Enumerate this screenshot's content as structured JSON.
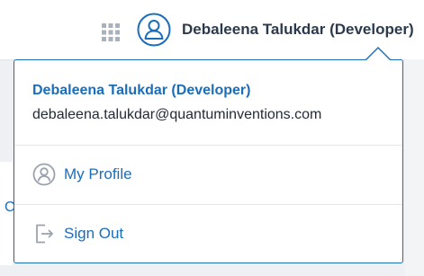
{
  "header": {
    "apps_icon": "grid-apps-icon",
    "avatar_icon": "user-avatar-icon",
    "user_name": "Debaleena Talukdar (Developer)"
  },
  "dropdown": {
    "user_name": "Debaleena Talukdar (Developer)",
    "email": "debaleena.talukdar@quantuminventions.com",
    "items": [
      {
        "label": "My Profile",
        "icon": "user-circle-icon"
      },
      {
        "label": "Sign Out",
        "icon": "sign-out-icon"
      }
    ]
  },
  "background": {
    "partial_letter": "C"
  },
  "colors": {
    "accent": "#1a6dbb",
    "text_dark": "#2b3a4d",
    "icon_gray": "#9aa3ad"
  }
}
